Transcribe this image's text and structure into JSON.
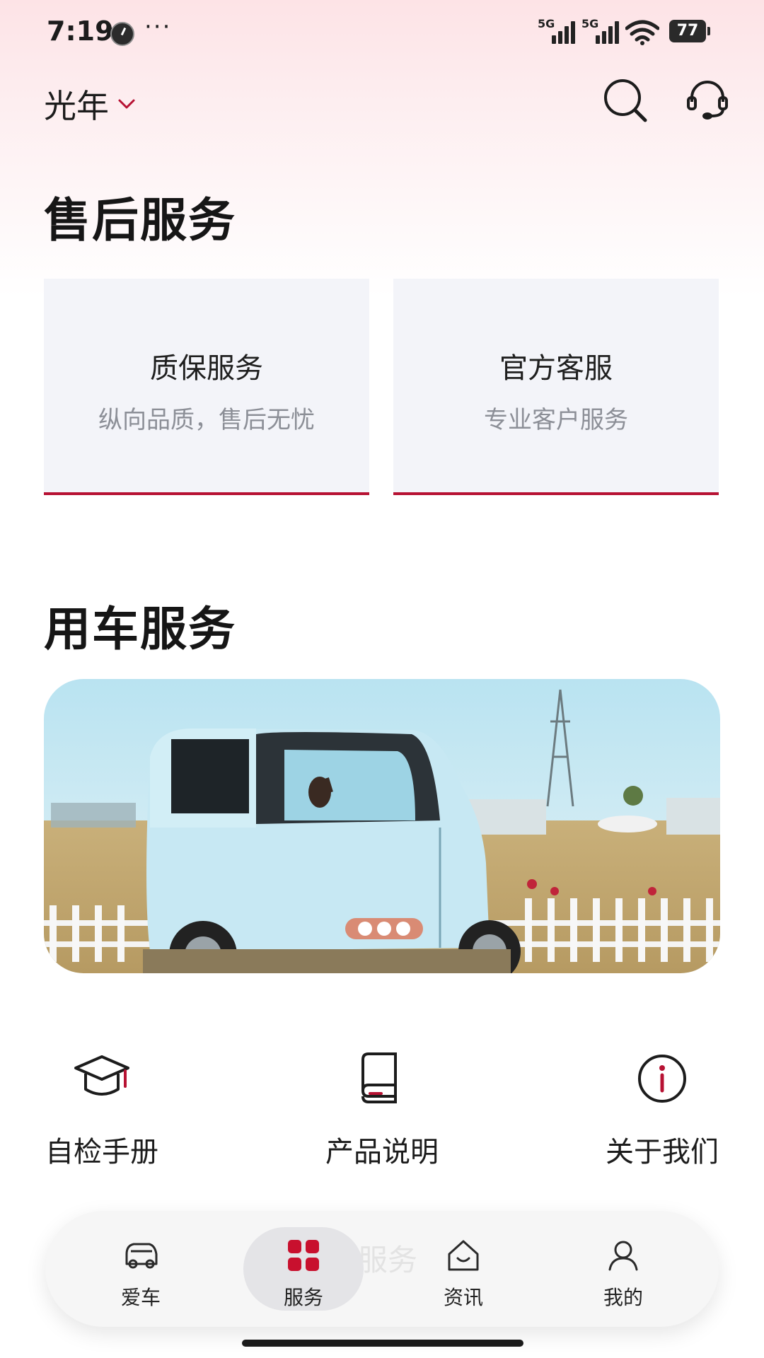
{
  "status_bar": {
    "time": "7:19",
    "dots": "···",
    "signal1_label": "5G",
    "signal2_label": "5G",
    "battery": "77"
  },
  "header": {
    "brand": "光年",
    "icons": [
      "chevron-down-icon",
      "search-icon",
      "headset-icon"
    ]
  },
  "after_sales": {
    "title": "售后服务",
    "cards": [
      {
        "title": "质保服务",
        "subtitle": "纵向品质，售后无忧"
      },
      {
        "title": "官方客服",
        "subtitle": "专业客户服务"
      }
    ]
  },
  "car_service": {
    "title": "用车服务",
    "banner_icon": "car-banner-image",
    "items": [
      {
        "label": "自检手册",
        "icon": "graduation-cap-icon"
      },
      {
        "label": "产品说明",
        "icon": "manual-book-icon"
      },
      {
        "label": "关于我们",
        "icon": "info-icon"
      }
    ]
  },
  "bottom_nav": {
    "ghost_text": "服务",
    "items": [
      {
        "label": "爱车",
        "icon": "car-icon"
      },
      {
        "label": "服务",
        "icon": "grid-icon",
        "active": true
      },
      {
        "label": "资讯",
        "icon": "home-news-icon"
      },
      {
        "label": "我的",
        "icon": "user-icon"
      }
    ]
  },
  "colors": {
    "accent": "#b71233",
    "card_bg": "#f3f4f9",
    "header_gradient_top": "#fde3e6"
  }
}
